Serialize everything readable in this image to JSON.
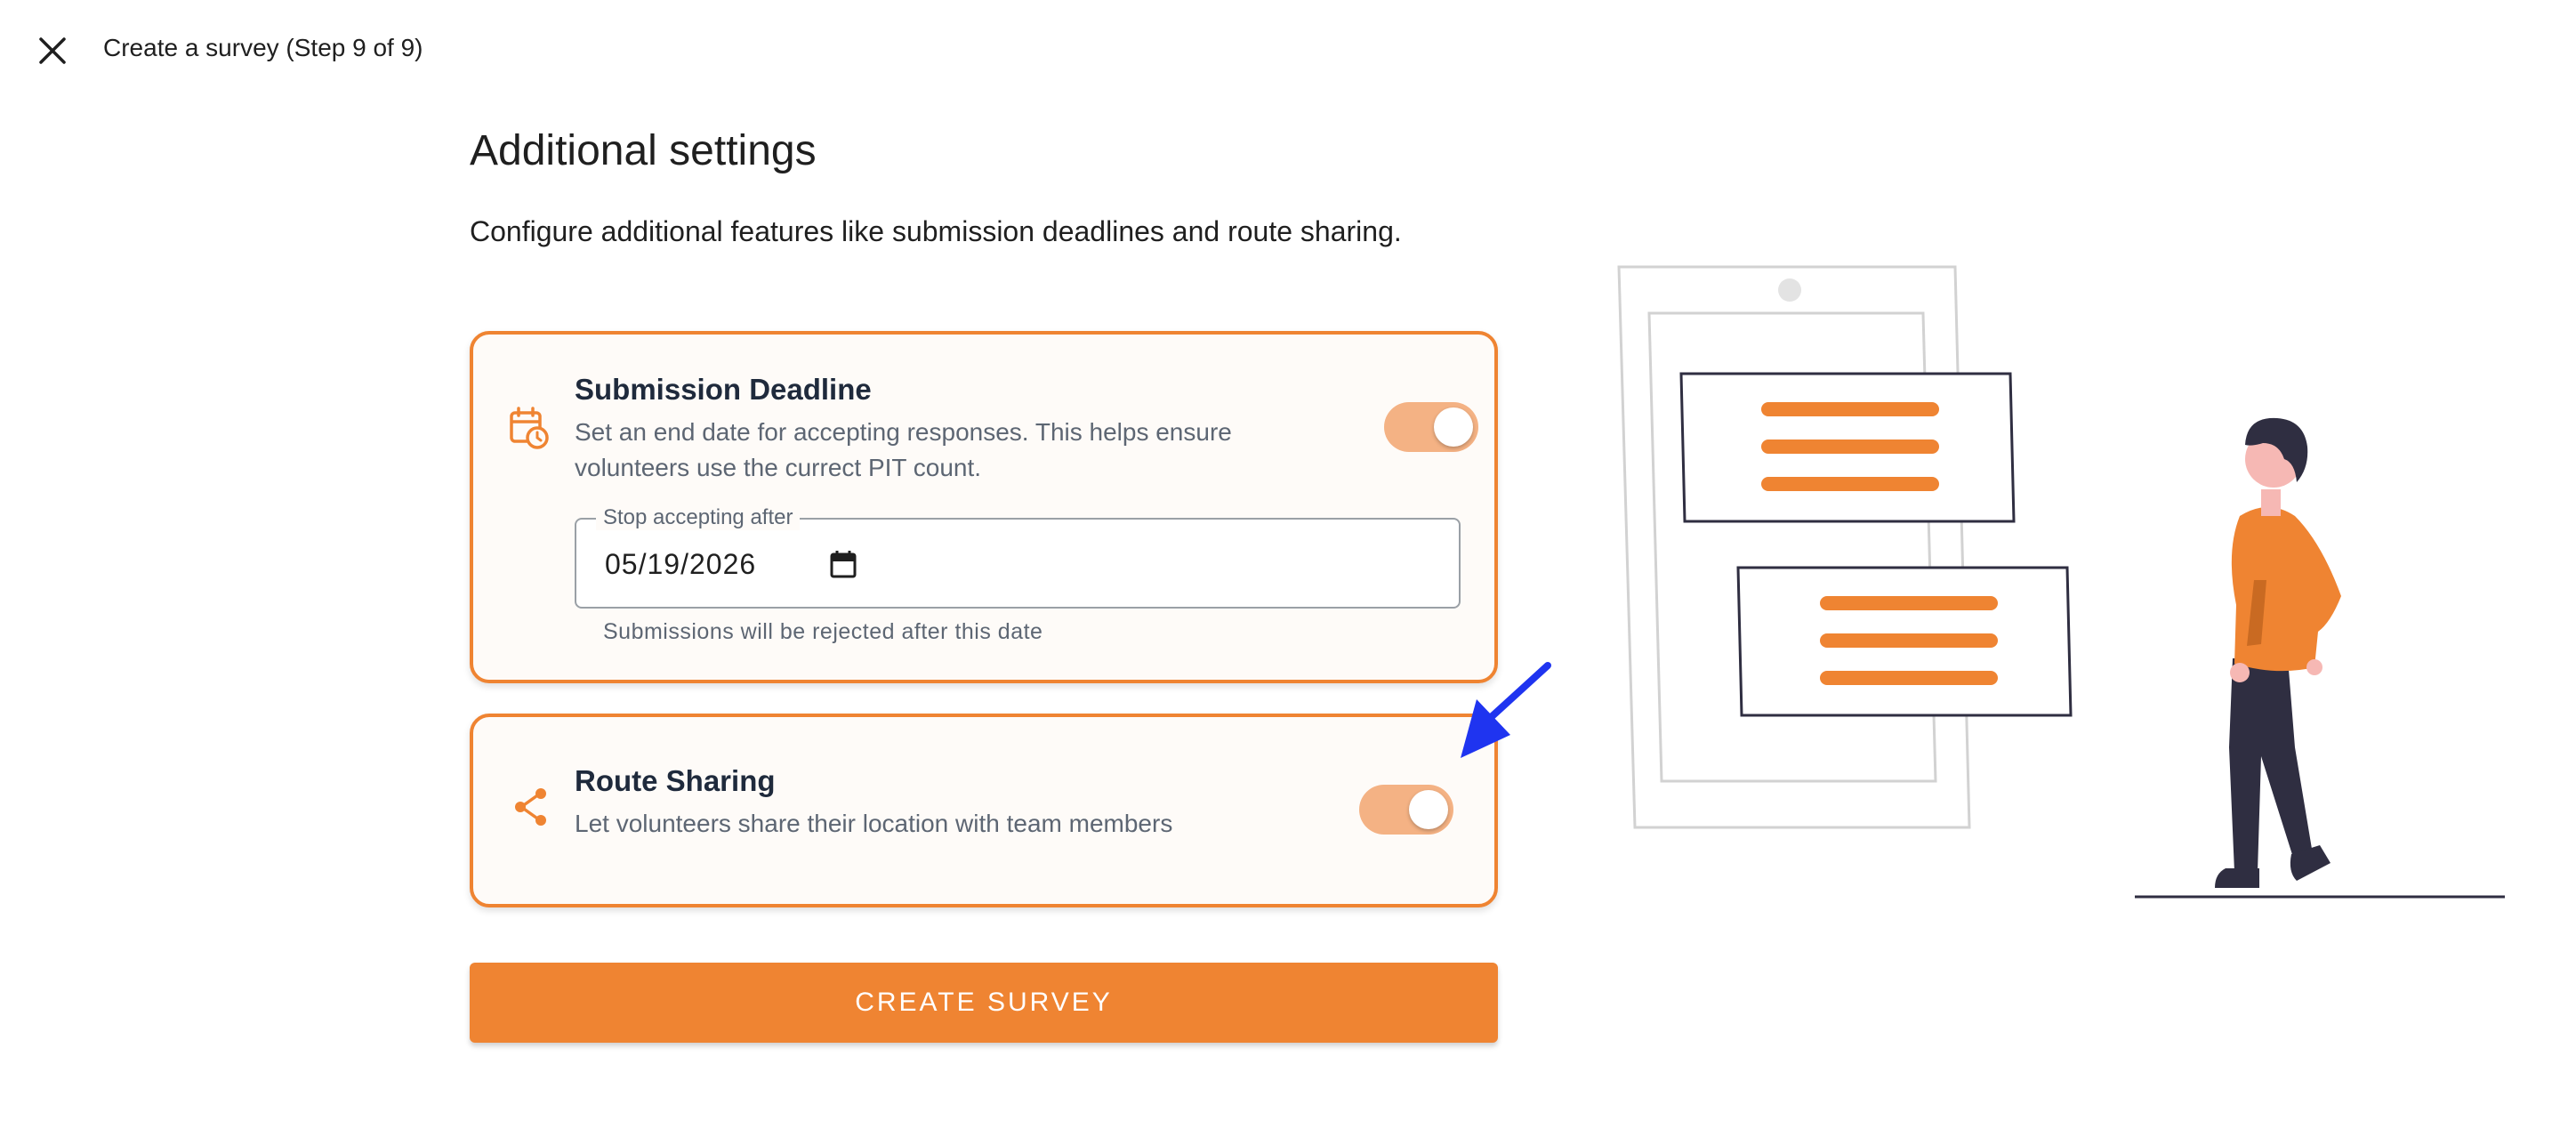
{
  "header": {
    "title": "Create a survey (Step 9 of 9)",
    "close_icon": "close-icon"
  },
  "main": {
    "title": "Additional settings",
    "description": "Configure additional features like submission deadlines and route sharing."
  },
  "submission_deadline": {
    "icon": "calendar-clock-icon",
    "title": "Submission Deadline",
    "description": "Set an end date for accepting responses. This helps ensure volunteers use the currect PIT count.",
    "enabled": true,
    "date_field": {
      "label": "Stop accepting after",
      "value": "05/19/2026",
      "helper": "Submissions will be rejected after this date",
      "calendar_icon": "calendar-icon"
    }
  },
  "route_sharing": {
    "icon": "share-icon",
    "title": "Route Sharing",
    "description": "Let volunteers share their location with team members",
    "enabled": true
  },
  "actions": {
    "create_label": "Create Survey"
  },
  "colors": {
    "accent": "#ef8432",
    "toggle_track": "#f4b284",
    "card_background": "#fefbf8",
    "title_text": "#1f2a3c",
    "muted_text": "#5d6673",
    "annotation_arrow": "#1f34f0"
  }
}
